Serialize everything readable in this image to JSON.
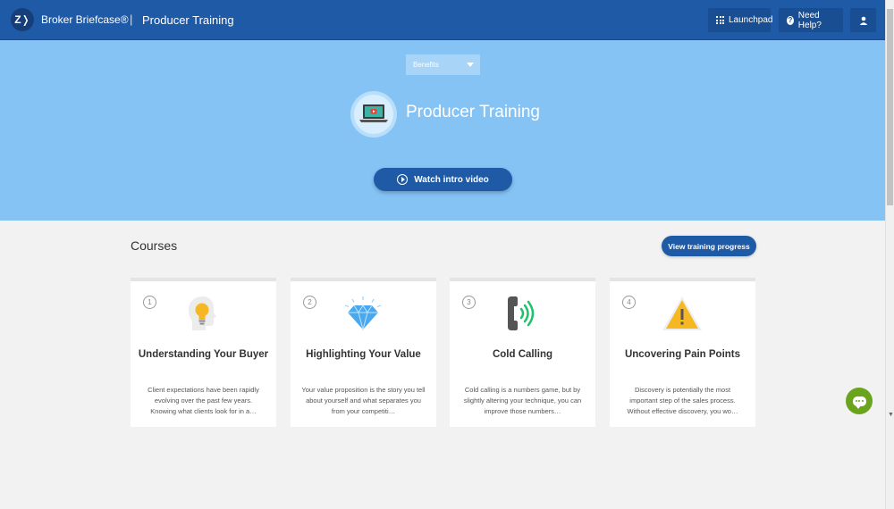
{
  "header": {
    "logo_text": "Z❭",
    "brand": "Broker Briefcase®",
    "separator": "|",
    "app_title": "Producer Training",
    "launchpad_label": "Launchpad",
    "help_label": "Need Help?",
    "icons": [
      "grid-icon",
      "help-icon",
      "user-icon"
    ]
  },
  "hero": {
    "dropdown_value": "Benefits",
    "title": "Producer Training",
    "watch_label": "Watch intro video",
    "icon": "laptop-video-icon"
  },
  "courses": {
    "heading": "Courses",
    "progress_label": "View training progress",
    "items": [
      {
        "num": "1",
        "title": "Understanding Your Buyer",
        "desc": "Client expectations have been rapidly evolving over the past few years. Knowing what clients look for in a…",
        "icon": "lightbulb-head-icon"
      },
      {
        "num": "2",
        "title": "Highlighting Your Value",
        "desc": "Your value proposition is the story you tell about yourself and what separates you from your competiti…",
        "icon": "diamond-icon"
      },
      {
        "num": "3",
        "title": "Cold Calling",
        "desc": "Cold calling is a numbers game, but by slightly altering your technique, you can improve those numbers…",
        "icon": "phone-ringing-icon"
      },
      {
        "num": "4",
        "title": "Uncovering Pain Points",
        "desc": "Discovery is potentially the most important step of the sales process. Without effective discovery, you wo…",
        "icon": "warning-icon"
      }
    ]
  },
  "colors": {
    "header_bg": "#1f5aa6",
    "hero_bg": "#85c3f5",
    "page_bg": "#f2f2f2",
    "chat_bg": "#6aa41f"
  }
}
